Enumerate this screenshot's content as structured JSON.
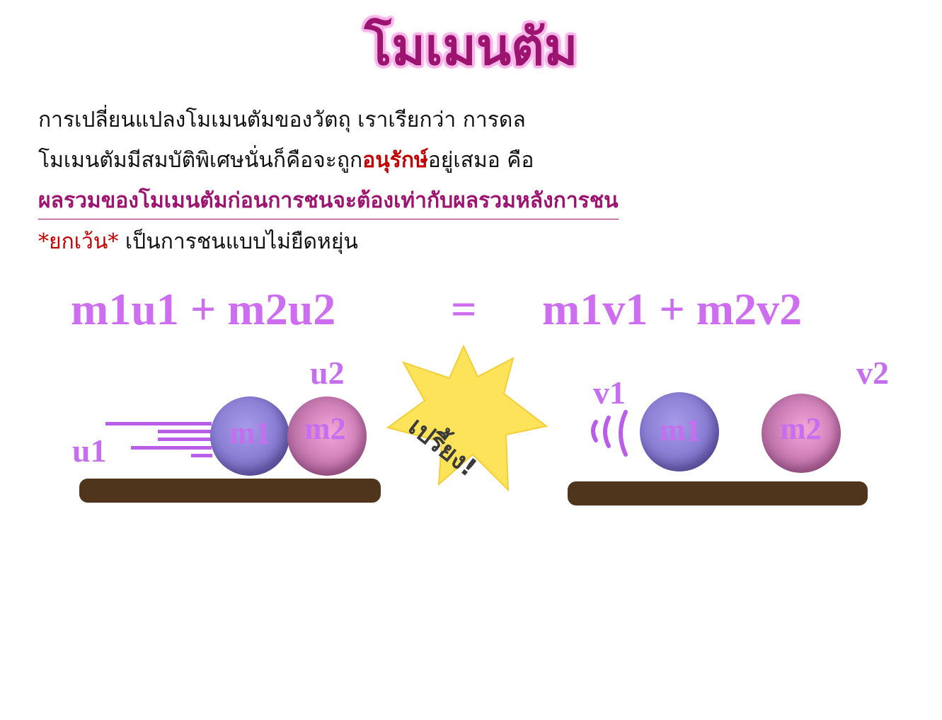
{
  "title": "โมเมนตัม",
  "lines": {
    "line1": "การเปลี่ยนแปลงโมเมนตัมของวัตถุ เราเรียกว่า การดล",
    "line2_before": "โมเมนตัมมีสมบัติพิเศษนั่นก็คือจะถูก",
    "line2_highlight": "อนุรักษ์",
    "line2_after": "อยู่เสมอ คือ",
    "line3": "ผลรวมของโมเมนตัมก่อนการชนจะต้องเท่ากับผลรวมหลังการชน",
    "line4_highlight": "*ยกเว้น*",
    "line4_rest": " เป็นการชนแบบไม่ยืดหยุ่น"
  },
  "equation": {
    "left": "m1u1 + m2u2",
    "sign": "=",
    "right": "m1v1 + m2v2"
  },
  "before": {
    "u1": "u1",
    "u2": "u2",
    "m1": "m1",
    "m2": "m2"
  },
  "collision": {
    "sound": "เปรี้ยง!"
  },
  "after": {
    "v1": "v1",
    "v2": "v2",
    "m1": "m1",
    "m2": "m2"
  },
  "colors": {
    "title": "#9c1470",
    "title_glow": "#f7b7ea",
    "highlight_red": "#c00000",
    "equation": "#cd6ef0",
    "ground": "#4e351c",
    "burst": "#fde35a"
  },
  "icons": {
    "speed_lines": "speed-lines-icon",
    "burst": "collision-burst-icon",
    "recoil": "recoil-lines-icon"
  }
}
